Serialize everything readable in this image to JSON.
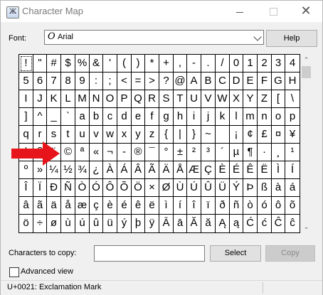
{
  "window": {
    "title": "Character Map",
    "icon": "character-map-app-icon",
    "controls": [
      "minimize-icon",
      "maximize-icon",
      "close-icon"
    ],
    "close_glyph": "✕"
  },
  "font": {
    "label": "Font:",
    "selected": "Arial",
    "font_type_glyph": "O"
  },
  "help_label": "Help",
  "grid": {
    "rows": [
      [
        "!",
        "\"",
        "#",
        "$",
        "%",
        "&",
        "'",
        "(",
        ")",
        "*",
        "+",
        ",",
        "-",
        ".",
        "/",
        "0",
        "1",
        "2",
        "3",
        "4"
      ],
      [
        "5",
        "6",
        "7",
        "8",
        "9",
        ":",
        ";",
        "<",
        "=",
        ">",
        "?",
        "@",
        "A",
        "B",
        "C",
        "D",
        "E",
        "F",
        "G",
        "H"
      ],
      [
        "I",
        "J",
        "K",
        "L",
        "M",
        "N",
        "O",
        "P",
        "Q",
        "R",
        "S",
        "T",
        "U",
        "V",
        "W",
        "X",
        "Y",
        "Z",
        "[",
        "\\"
      ],
      [
        "]",
        "^",
        "_",
        "`",
        "a",
        "b",
        "c",
        "d",
        "e",
        "f",
        "g",
        "h",
        "i",
        "j",
        "k",
        "l",
        "m",
        "n",
        "o",
        "p"
      ],
      [
        "q",
        "r",
        "s",
        "t",
        "u",
        "v",
        "w",
        "x",
        "y",
        "z",
        "{",
        "|",
        "}",
        "~",
        " ",
        "¡",
        "¢",
        "£",
        "¤",
        "¥"
      ],
      [
        "¦",
        "§",
        "¨",
        "©",
        "ª",
        "«",
        "¬",
        "-",
        "®",
        "¯",
        "°",
        "±",
        "²",
        "³",
        "´",
        "µ",
        "¶",
        "·",
        "¸",
        "¹"
      ],
      [
        "º",
        "»",
        "¼",
        "½",
        "¾",
        "¿",
        "À",
        "Á",
        "Â",
        "Ã",
        "Ä",
        "Å",
        "Æ",
        "Ç",
        "È",
        "É",
        "Ê",
        "Ë",
        "Ì",
        "Í"
      ],
      [
        "Î",
        "Ï",
        "Ð",
        "Ñ",
        "Ò",
        "Ó",
        "Ô",
        "Õ",
        "Ö",
        "×",
        "Ø",
        "Ù",
        "Ú",
        "Û",
        "Ü",
        "Ý",
        "Þ",
        "ß",
        "à",
        "á"
      ],
      [
        "â",
        "ã",
        "ä",
        "å",
        "æ",
        "ç",
        "è",
        "é",
        "ê",
        "ë",
        "ì",
        "í",
        "î",
        "ï",
        "ð",
        "ñ",
        "ò",
        "ó",
        "ô",
        "õ"
      ],
      [
        "ö",
        "÷",
        "ø",
        "ù",
        "ú",
        "û",
        "ü",
        "ý",
        "þ",
        "ÿ",
        "Ā",
        "ā",
        "Ă",
        "ă",
        "Ą",
        "ą",
        "Ć",
        "ć",
        "Ĉ",
        "ĉ"
      ]
    ],
    "selected_char": "!"
  },
  "scrollbar": {
    "up_glyph": "⌃",
    "down_glyph": "⌄"
  },
  "annotation": {
    "icon": "red-arrow-icon",
    "color": "#e8141b",
    "points_to": "©"
  },
  "characters_to_copy": {
    "label": "Characters to copy:",
    "value": ""
  },
  "select_label": "Select",
  "copy_label": "Copy",
  "advanced_view": {
    "label": "Advanced view",
    "checked": false
  },
  "status": "U+0021: Exclamation Mark"
}
